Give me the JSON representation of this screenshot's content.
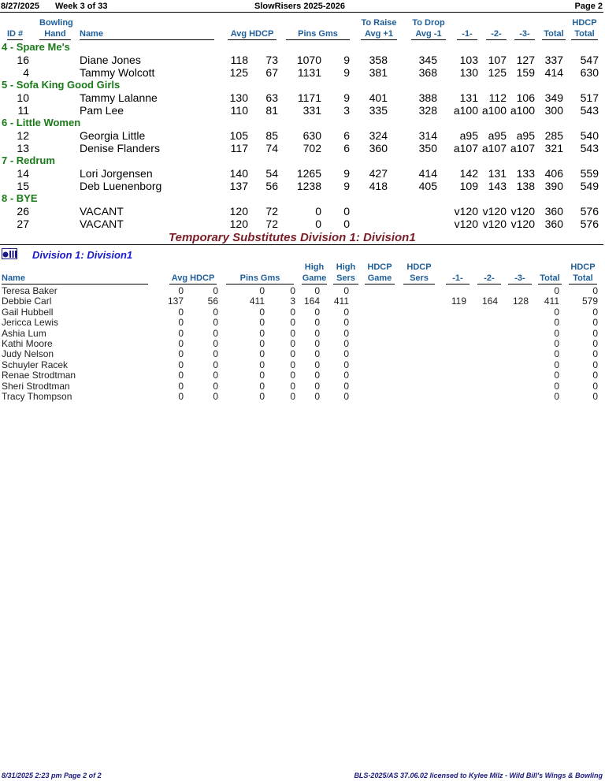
{
  "header": {
    "date": "8/27/2025",
    "week": "Week 3 of 33",
    "league": "SlowRisers 2025-2026",
    "page": "Page 2"
  },
  "columns": {
    "id": "ID #",
    "bowling": "Bowling",
    "hand": "Hand",
    "name": "Name",
    "avg_hdcp": "Avg HDCP",
    "pins_gms": "Pins  Gms",
    "to_raise": "To Raise",
    "avg_plus": "Avg +1",
    "to_drop": "To Drop",
    "avg_minus": "Avg -1",
    "g1": "-1-",
    "g2": "-2-",
    "g3": "-3-",
    "total": "Total",
    "hdcp": "HDCP",
    "hdcp_total": "Total"
  },
  "teams": [
    {
      "label": "4 - Spare Me's",
      "bowlers": [
        {
          "id": "16",
          "name": "Diane Jones",
          "avg": "118",
          "hdcp": "73",
          "pins": "1070",
          "gms": "9",
          "raise": "358",
          "drop": "345",
          "g1": "103",
          "g2": "107",
          "g3": "127",
          "total": "337",
          "htotal": "547"
        },
        {
          "id": "4",
          "name": "Tammy Wolcott",
          "avg": "125",
          "hdcp": "67",
          "pins": "1131",
          "gms": "9",
          "raise": "381",
          "drop": "368",
          "g1": "130",
          "g2": "125",
          "g3": "159",
          "total": "414",
          "htotal": "630"
        }
      ]
    },
    {
      "label": "5 - Sofa King Good Girls",
      "bowlers": [
        {
          "id": "10",
          "name": "Tammy Lalanne",
          "avg": "130",
          "hdcp": "63",
          "pins": "1171",
          "gms": "9",
          "raise": "401",
          "drop": "388",
          "g1": "131",
          "g2": "112",
          "g3": "106",
          "total": "349",
          "htotal": "517"
        },
        {
          "id": "11",
          "name": "Pam Lee",
          "avg": "110",
          "hdcp": "81",
          "pins": "331",
          "gms": "3",
          "raise": "335",
          "drop": "328",
          "g1": "a100",
          "g2": "a100",
          "g3": "a100",
          "total": "300",
          "htotal": "543"
        }
      ]
    },
    {
      "label": "6 - Little Women",
      "bowlers": [
        {
          "id": "12",
          "name": "Georgia Little",
          "avg": "105",
          "hdcp": "85",
          "pins": "630",
          "gms": "6",
          "raise": "324",
          "drop": "314",
          "g1": "a95",
          "g2": "a95",
          "g3": "a95",
          "total": "285",
          "htotal": "540"
        },
        {
          "id": "13",
          "name": "Denise Flanders",
          "avg": "117",
          "hdcp": "74",
          "pins": "702",
          "gms": "6",
          "raise": "360",
          "drop": "350",
          "g1": "a107",
          "g2": "a107",
          "g3": "a107",
          "total": "321",
          "htotal": "543"
        }
      ]
    },
    {
      "label": "7 - Redrum",
      "bowlers": [
        {
          "id": "14",
          "name": "Lori Jorgensen",
          "avg": "140",
          "hdcp": "54",
          "pins": "1265",
          "gms": "9",
          "raise": "427",
          "drop": "414",
          "g1": "142",
          "g2": "131",
          "g3": "133",
          "total": "406",
          "htotal": "559"
        },
        {
          "id": "15",
          "name": "Deb Luenenborg",
          "avg": "137",
          "hdcp": "56",
          "pins": "1238",
          "gms": "9",
          "raise": "418",
          "drop": "405",
          "g1": "109",
          "g2": "143",
          "g3": "138",
          "total": "390",
          "htotal": "549"
        }
      ]
    },
    {
      "label": "8 - BYE",
      "bowlers": [
        {
          "id": "26",
          "name": "VACANT",
          "avg": "120",
          "hdcp": "72",
          "pins": "0",
          "gms": "0",
          "raise": "",
          "drop": "",
          "g1": "v120",
          "g2": "v120",
          "g3": "v120",
          "total": "360",
          "htotal": "576"
        },
        {
          "id": "27",
          "name": "VACANT",
          "avg": "120",
          "hdcp": "72",
          "pins": "0",
          "gms": "0",
          "raise": "",
          "drop": "",
          "g1": "v120",
          "g2": "v120",
          "g3": "v120",
          "total": "360",
          "htotal": "576"
        }
      ]
    }
  ],
  "temp_title": "Temporary Substitutes   Division 1: Division1",
  "division_title": "Division 1: Division1",
  "sub_columns": {
    "name": "Name",
    "avg_hdcp": "Avg HDCP",
    "pins_gms": "Pins  Gms",
    "high": "High",
    "game": "Game",
    "high2": "High",
    "sers": "Sers",
    "hdcp_game_top": "HDCP",
    "hdcp_game": "Game",
    "hdcp_sers_top": "HDCP",
    "hdcp_sers": "Sers",
    "g1": "-1-",
    "g2": "-2-",
    "g3": "-3-",
    "total": "Total",
    "hdcp_total_top": "HDCP",
    "hdcp_total": "Total"
  },
  "subs": [
    {
      "name": "Teresa Baker",
      "avg": "0",
      "hdcp": "0",
      "pins": "0",
      "gms": "0",
      "hg": "0",
      "hs": "0",
      "g1": "",
      "g2": "",
      "g3": "",
      "total": "0",
      "htotal": "0"
    },
    {
      "name": "Debbie Carl",
      "avg": "137",
      "hdcp": "56",
      "pins": "411",
      "gms": "3",
      "hg": "164",
      "hs": "411",
      "g1": "119",
      "g2": "164",
      "g3": "128",
      "total": "411",
      "htotal": "579"
    },
    {
      "name": "Gail Hubbell",
      "avg": "0",
      "hdcp": "0",
      "pins": "0",
      "gms": "0",
      "hg": "0",
      "hs": "0",
      "g1": "",
      "g2": "",
      "g3": "",
      "total": "0",
      "htotal": "0"
    },
    {
      "name": "Jericca Lewis",
      "avg": "0",
      "hdcp": "0",
      "pins": "0",
      "gms": "0",
      "hg": "0",
      "hs": "0",
      "g1": "",
      "g2": "",
      "g3": "",
      "total": "0",
      "htotal": "0"
    },
    {
      "name": "Ashia Lum",
      "avg": "0",
      "hdcp": "0",
      "pins": "0",
      "gms": "0",
      "hg": "0",
      "hs": "0",
      "g1": "",
      "g2": "",
      "g3": "",
      "total": "0",
      "htotal": "0"
    },
    {
      "name": "Kathi Moore",
      "avg": "0",
      "hdcp": "0",
      "pins": "0",
      "gms": "0",
      "hg": "0",
      "hs": "0",
      "g1": "",
      "g2": "",
      "g3": "",
      "total": "0",
      "htotal": "0"
    },
    {
      "name": "Judy Nelson",
      "avg": "0",
      "hdcp": "0",
      "pins": "0",
      "gms": "0",
      "hg": "0",
      "hs": "0",
      "g1": "",
      "g2": "",
      "g3": "",
      "total": "0",
      "htotal": "0"
    },
    {
      "name": "Schuyler Racek",
      "avg": "0",
      "hdcp": "0",
      "pins": "0",
      "gms": "0",
      "hg": "0",
      "hs": "0",
      "g1": "",
      "g2": "",
      "g3": "",
      "total": "0",
      "htotal": "0"
    },
    {
      "name": "Renae Strodtman",
      "avg": "0",
      "hdcp": "0",
      "pins": "0",
      "gms": "0",
      "hg": "0",
      "hs": "0",
      "g1": "",
      "g2": "",
      "g3": "",
      "total": "0",
      "htotal": "0"
    },
    {
      "name": "Sheri Strodtman",
      "avg": "0",
      "hdcp": "0",
      "pins": "0",
      "gms": "0",
      "hg": "0",
      "hs": "0",
      "g1": "",
      "g2": "",
      "g3": "",
      "total": "0",
      "htotal": "0"
    },
    {
      "name": "Tracy Thompson",
      "avg": "0",
      "hdcp": "0",
      "pins": "0",
      "gms": "0",
      "hg": "0",
      "hs": "0",
      "g1": "",
      "g2": "",
      "g3": "",
      "total": "0",
      "htotal": "0"
    }
  ],
  "footer": {
    "left": "8/31/2025  2:23 pm  Page 2 of 2",
    "right": "BLS-2025/AS 37.06.02 licensed to Kylee Milz - Wild Bill's Wings & Bowling"
  }
}
